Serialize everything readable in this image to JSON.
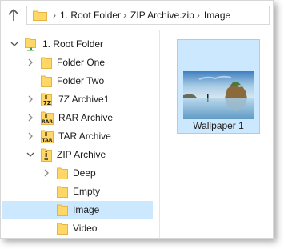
{
  "address": {
    "crumbs": [
      "1. Root Folder",
      "ZIP Archive.zip",
      "Image"
    ]
  },
  "nav": {
    "items": [
      {
        "label": "1. Root Folder",
        "icon": "root-folder-icon",
        "expanded": true
      },
      {
        "label": "Folder One",
        "icon": "folder-icon"
      },
      {
        "label": "Folder Two",
        "icon": "folder-icon"
      },
      {
        "label": "7Z Archive1",
        "icon": "7z-archive-icon",
        "badge": "7Z"
      },
      {
        "label": "RAR Archive",
        "icon": "rar-archive-icon",
        "badge": "RAR"
      },
      {
        "label": "TAR Archive",
        "icon": "tar-archive-icon",
        "badge": "TAR"
      },
      {
        "label": "ZIP Archive",
        "icon": "zip-archive-icon",
        "expanded": true
      },
      {
        "label": "Deep",
        "icon": "folder-icon"
      },
      {
        "label": "Empty",
        "icon": "folder-icon"
      },
      {
        "label": "Image",
        "icon": "folder-icon",
        "selected": true
      },
      {
        "label": "Video",
        "icon": "folder-icon"
      }
    ]
  },
  "content": {
    "items": [
      {
        "label": "Wallpaper 1",
        "icon": "image-thumbnail"
      }
    ]
  },
  "colors": {
    "selection": "#cce8ff",
    "selection_border": "#99d1ff",
    "folder": "#ffd766"
  }
}
